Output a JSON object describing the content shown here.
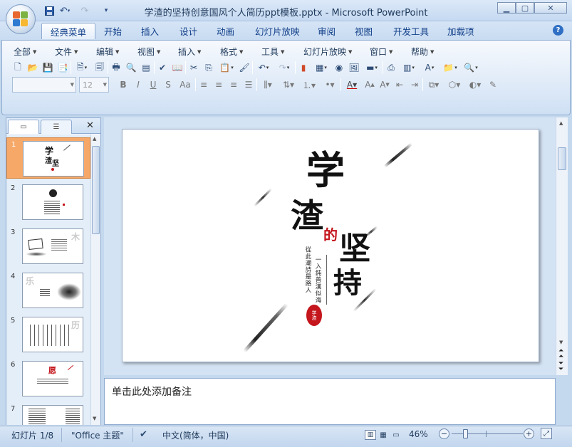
{
  "window": {
    "title": "学渣的坚持创意国风个人简历ppt模板.pptx - Microsoft PowerPoint",
    "minimize": "▁",
    "maximize": "▢",
    "close": "✕"
  },
  "qat": {
    "save_icon": "save-icon",
    "undo_icon": "undo-icon",
    "redo_icon": "redo-icon",
    "customize": "▾"
  },
  "tabs": [
    {
      "label": "经典菜单"
    },
    {
      "label": "开始"
    },
    {
      "label": "插入"
    },
    {
      "label": "设计"
    },
    {
      "label": "动画"
    },
    {
      "label": "幻灯片放映"
    },
    {
      "label": "审阅"
    },
    {
      "label": "视图"
    },
    {
      "label": "开发工具"
    },
    {
      "label": "加载项"
    }
  ],
  "help": "?",
  "menus": [
    {
      "label": "全部"
    },
    {
      "label": "文件"
    },
    {
      "label": "编辑"
    },
    {
      "label": "视图"
    },
    {
      "label": "插入"
    },
    {
      "label": "格式"
    },
    {
      "label": "工具"
    },
    {
      "label": "幻灯片放映"
    },
    {
      "label": "窗口"
    },
    {
      "label": "帮助"
    }
  ],
  "font": {
    "name": "",
    "size": "12"
  },
  "format_buttons": {
    "bold": "B",
    "italic": "I",
    "underline": "U",
    "shadow": "S",
    "case": "Aa"
  },
  "slides": [
    {
      "num": "1"
    },
    {
      "num": "2"
    },
    {
      "num": "3"
    },
    {
      "num": "4"
    },
    {
      "num": "5"
    },
    {
      "num": "6"
    },
    {
      "num": "7"
    }
  ],
  "selected_slide": 1,
  "slide_content": {
    "title_char1": "学",
    "title_char2": "渣",
    "title_char3": "的",
    "title_char4": "坚",
    "title_char5": "持",
    "poem_col1": "一入鈍普漢似海",
    "poem_col2": "從此潮詩是路人",
    "seal": "学渣"
  },
  "notes_placeholder": "单击此处添加备注",
  "status": {
    "slide": "幻灯片 1/8",
    "theme": "\"Office 主题\"",
    "language": "中文(简体，中国)",
    "zoom": "46%"
  },
  "colors": {
    "accent": "#f6a868",
    "seal": "#c4161c"
  }
}
